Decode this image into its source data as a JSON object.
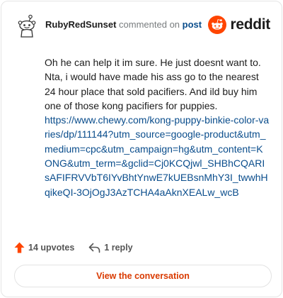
{
  "comment": {
    "username": "RubyRedSunset",
    "commented_on_text": "commented on",
    "post_link_text": "post",
    "body": "Oh he can help it im sure. He just doesnt want to. Nta, i would have made his ass go to the nearest 24 hour place that sold pacifiers. And ild buy him one of those kong pacifiers for puppies.",
    "link": "https://www.chewy.com/kong-puppy-binkie-color-varies/dp/111144?utm_source=google-product&utm_medium=cpc&utm_campaign=hg&utm_content=KONG&utm_term=&gclid=Cj0KCQjwl_SHBhCQARIsAFIFRVVbT6IYvBhtYnwE7kUEBsnMhY3I_twwhHqikeQI-3OjOgJ3AzTCHA4aAknXEALw_wcB"
  },
  "brand": {
    "name": "reddit",
    "color": "#ff4500"
  },
  "actions": {
    "upvotes": "14 upvotes",
    "replies": "1 reply",
    "upvote_icon": "upvote-arrow-icon",
    "reply_icon": "reply-arrow-icon",
    "upvote_color": "#ff4500"
  },
  "view_conversation": {
    "label": "View the conversation",
    "color": "#d93a00"
  }
}
